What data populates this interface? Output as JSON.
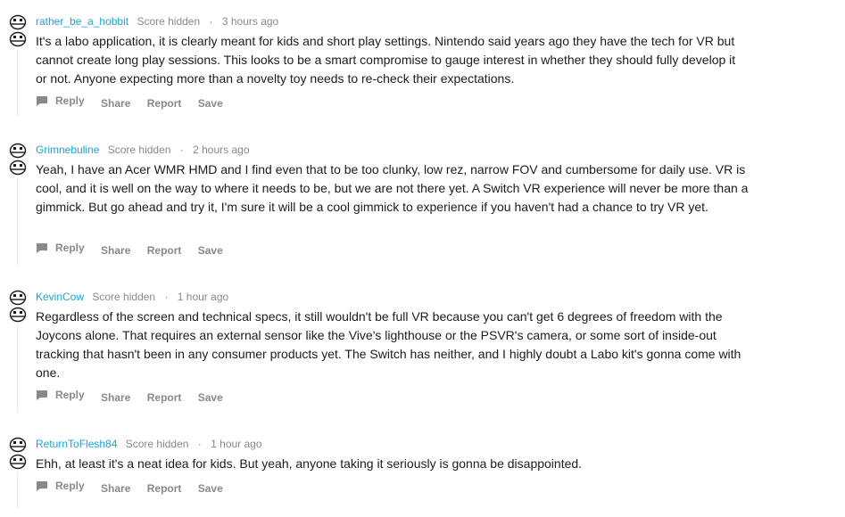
{
  "comments": [
    {
      "username": "rather_be_a_hobbit",
      "score": "Score hidden",
      "separator": "·",
      "time": "3 hours ago",
      "body": "It's a labo application, it is clearly meant for kids and short play settings. Nintendo said years ago they have the tech for VR but cannot create long play sessions. This looks to be a smart compromise to gauge interest in whether they should fully develop it or not. Anyone expecting more than a novelty toy needs to re-check their expectations.",
      "actions": {
        "reply": "Reply",
        "share": "Share",
        "report": "Report",
        "save": "Save"
      }
    },
    {
      "username": "Grimnebuline",
      "score": "Score hidden",
      "separator": "·",
      "time": "2 hours ago",
      "body": "Yeah, I have an Acer WMR HMD and I find even that to be too clunky, low rez, narrow FOV and cumbersome for daily use. VR is cool, and it is well on the way to where it needs to be, but we are not there yet. A Switch VR experience will never be more than a gimmick. But go ahead and try it, I'm sure it will be a cool gimmick to experience if you haven't had a chance to try VR yet.",
      "actions": {
        "reply": "Reply",
        "share": "Share",
        "report": "Report",
        "save": "Save"
      }
    },
    {
      "username": "KevinCow",
      "score": "Score hidden",
      "separator": "·",
      "time": "1 hour ago",
      "body": "Regardless of the screen and technical specs, it still wouldn't be full VR because you can't get 6 degrees of freedom with the Joycons alone. That requires an external sensor like the Vive's lighthouse or the PSVR's camera, or some sort of inside-out tracking that hasn't been in any consumer products yet. The Switch has neither, and I highly doubt a Labo kit's gonna come with one.",
      "actions": {
        "reply": "Reply",
        "share": "Share",
        "report": "Report",
        "save": "Save"
      }
    },
    {
      "username": "ReturnToFlesh84",
      "score": "Score hidden",
      "separator": "·",
      "time": "1 hour ago",
      "body": "Ehh, at least it's a neat idea for kids. But yeah, anyone taking it seriously is gonna be disappointed.",
      "actions": {
        "reply": "Reply",
        "share": "Share",
        "report": "Report",
        "save": "Save"
      }
    }
  ],
  "icons": {
    "avatar": "robot-avatar-icon",
    "reply": "comment-bubble-icon"
  },
  "colors": {
    "username": "#1aa3d8",
    "meta": "#878a8c",
    "body": "#1c1c1c",
    "thread_line": "#e6e6e6"
  }
}
